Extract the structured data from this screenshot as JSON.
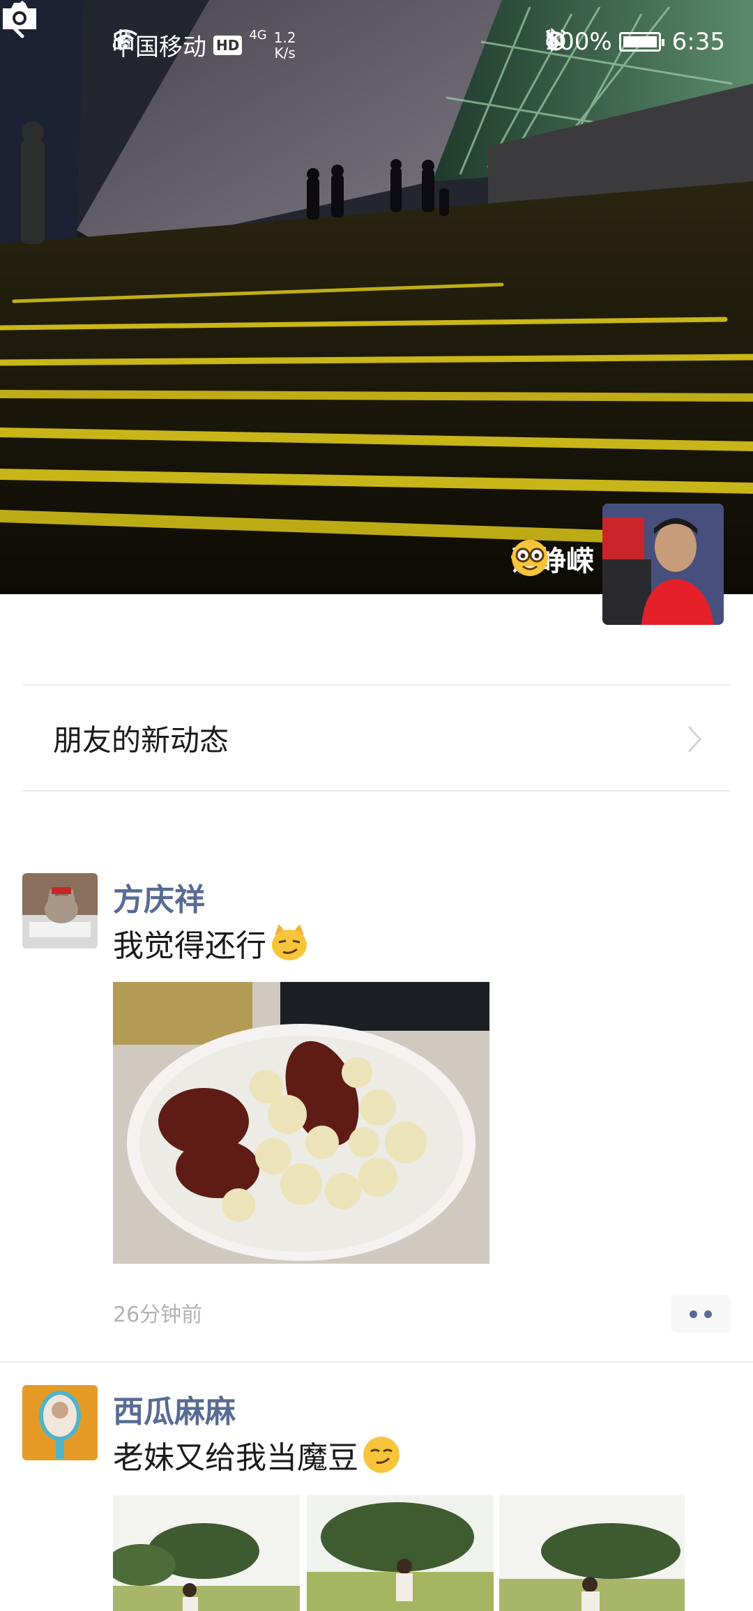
{
  "status_bar": {
    "carrier": "中国移动",
    "hd": "HD",
    "network": "4G",
    "speed_value": "1.2",
    "speed_unit": "K/s",
    "battery": "100%",
    "battery_level": 1.0,
    "time": "6:35"
  },
  "profile": {
    "username": "谢峥嵘",
    "username_emoji": "nerd-face-emoji"
  },
  "friends_updates": {
    "label": "朋友的新动态"
  },
  "posts": [
    {
      "name": "方庆祥",
      "text": "我觉得还行",
      "emoji": "smirking-cat-emoji",
      "time": "26分钟前",
      "images": [
        "food-photo"
      ]
    },
    {
      "name": "西瓜麻麻",
      "text": "老妹又给我当魔豆",
      "emoji": "smirking-face-emoji",
      "images": [
        "park-photo-1",
        "park-photo-2",
        "park-photo-3"
      ]
    }
  ],
  "colors": {
    "name_link": "#576b95",
    "divider": "#ececec",
    "time_gray": "#b2b2b2"
  }
}
